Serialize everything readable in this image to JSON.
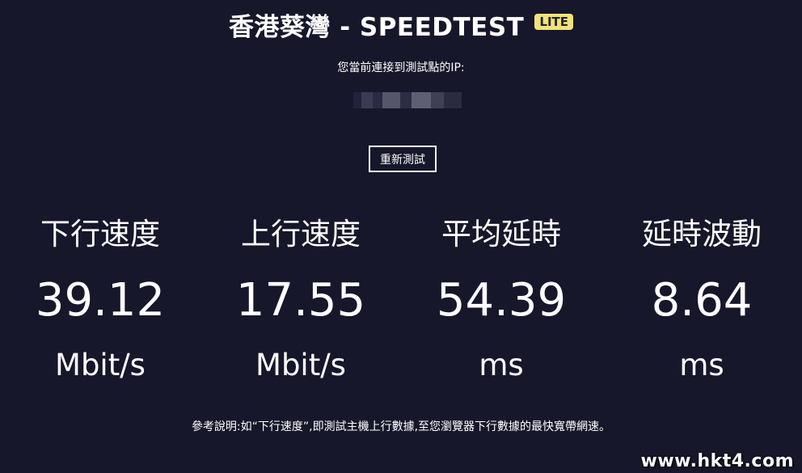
{
  "header": {
    "title": "香港葵灣 - SPEEDTEST",
    "badge": "LITE"
  },
  "connection": {
    "label": "您當前連接到測試點的IP:"
  },
  "actions": {
    "retest_label": "重新測試"
  },
  "metrics": [
    {
      "label": "下行速度",
      "value": "39.12",
      "unit": "Mbit/s"
    },
    {
      "label": "上行速度",
      "value": "17.55",
      "unit": "Mbit/s"
    },
    {
      "label": "平均延時",
      "value": "54.39",
      "unit": "ms"
    },
    {
      "label": "延時波動",
      "value": "8.64",
      "unit": "ms"
    }
  ],
  "footer": {
    "note": "參考說明:如“下行速度”,即測試主機上行數據,至您瀏覽器下行數據的最快寬帶網速。"
  },
  "watermark": "www.hkt4.com",
  "colors": {
    "background": "#16172a",
    "text": "#ffffff",
    "badge": "#f3e27a"
  }
}
